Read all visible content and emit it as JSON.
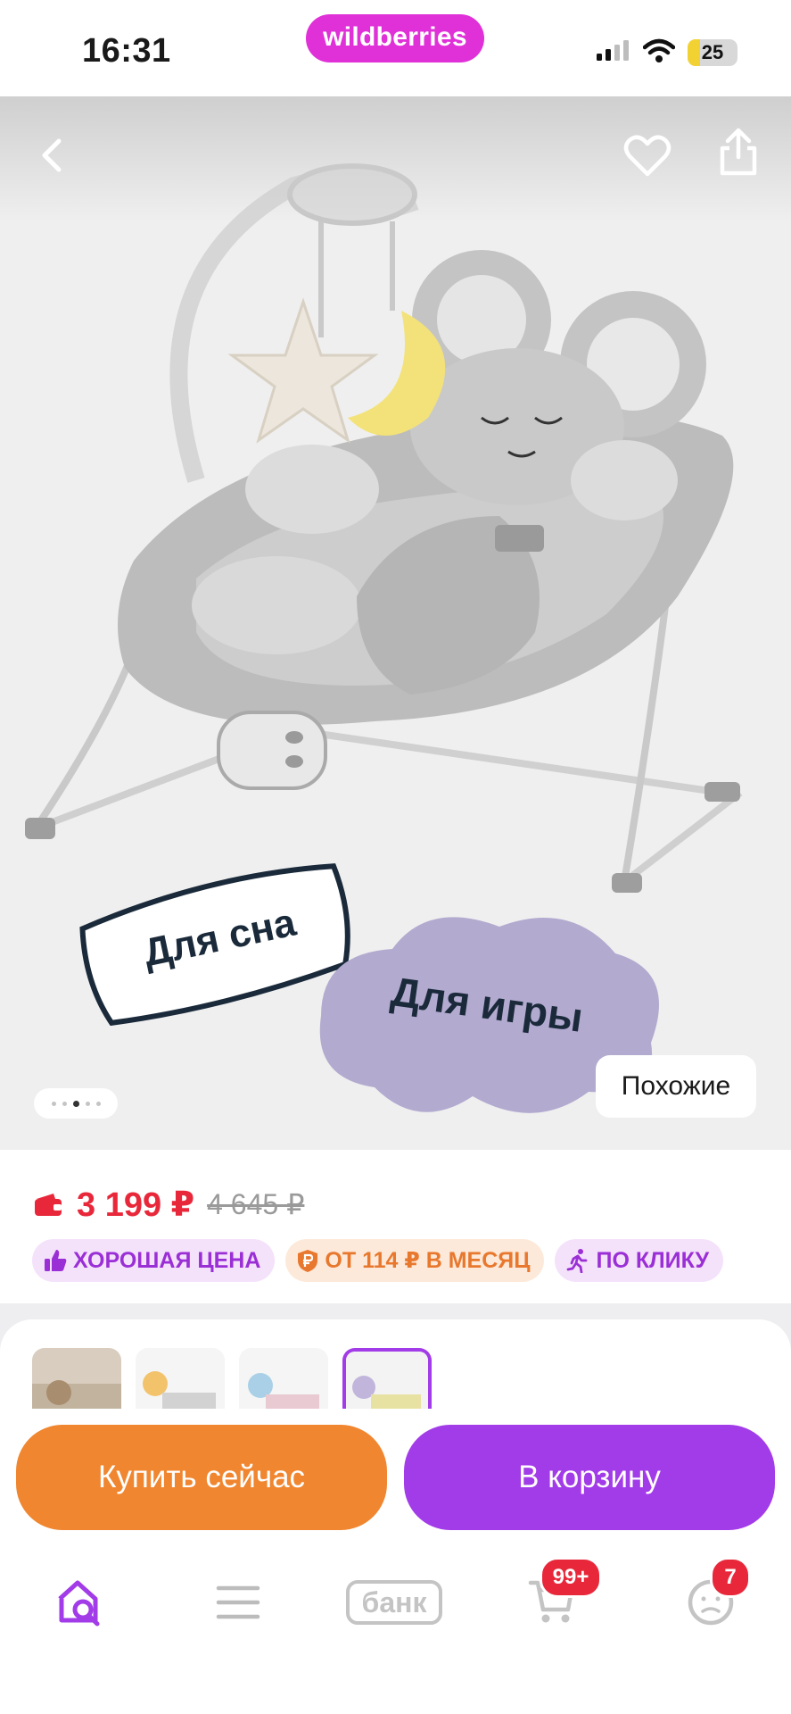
{
  "status_bar": {
    "time": "16:31",
    "brand": "wildberries",
    "battery_level": "25",
    "battery_fraction": 0.25,
    "icons": [
      "signal-icon",
      "wifi-icon",
      "battery-icon"
    ]
  },
  "product_image": {
    "labels": {
      "sleep": "Для сна",
      "play": "Для игры"
    },
    "pager": {
      "count": 5,
      "active": 3
    },
    "similar_label": "Похожие"
  },
  "price": {
    "current": "3 199 ₽",
    "old": "4 645 ₽"
  },
  "badges": [
    {
      "label": "ХОРОШАЯ ЦЕНА",
      "icon": "thumbs-up-icon"
    },
    {
      "label": "ОТ 114 ₽ В МЕСЯЦ",
      "icon": "shield-ruble-icon"
    },
    {
      "label": "ПО КЛИКУ",
      "icon": "running-person-icon"
    }
  ],
  "actions": {
    "buy_now": "Купить сейчас",
    "add_to_cart": "В корзину"
  },
  "tab_bar": {
    "items": [
      {
        "name": "home",
        "icon": "home-search-icon",
        "active": true
      },
      {
        "name": "catalog",
        "icon": "menu-icon"
      },
      {
        "name": "bank",
        "label": "банк",
        "icon": "bank-icon"
      },
      {
        "name": "cart",
        "icon": "cart-icon",
        "badge": "99+"
      },
      {
        "name": "profile",
        "icon": "profile-icon",
        "badge": "7"
      }
    ]
  },
  "colors": {
    "brand": "#e030d8",
    "price_red": "#e8283a",
    "purple": "#a23be8",
    "orange": "#f0862f"
  }
}
